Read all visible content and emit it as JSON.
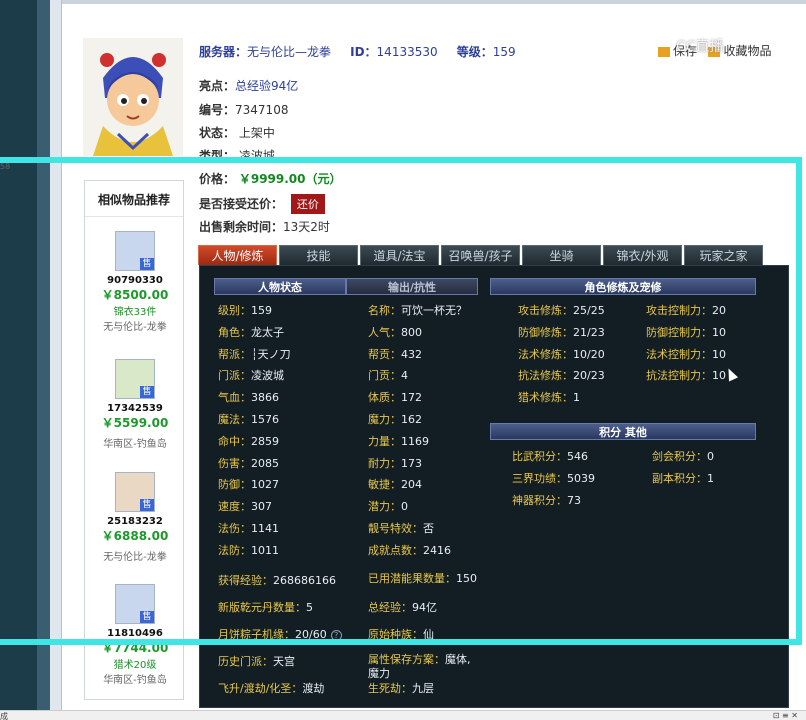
{
  "header": {
    "server_label": "服务器：",
    "server": "无与伦比—龙拳",
    "id_label": "ID：",
    "id": "14133530",
    "level_label": "等级：",
    "level": "159",
    "link1": "保存",
    "link2": "收藏物品",
    "watermark": "CC直播"
  },
  "item": {
    "highlight_label": "亮点：",
    "highlight": "总经验94亿",
    "number_label": "编号：",
    "number": "7347108",
    "status_label": "状态：",
    "status": "上架中",
    "type_label": "类型：",
    "type": "凌波城",
    "price_label": "价格：",
    "price": "￥9999.00（元）",
    "bargain_label": "是否接受还价：",
    "bargain_button": "还价",
    "time_label": "出售剩余时间：",
    "time": "13天2时"
  },
  "sidebar": {
    "title": "相似物品推荐",
    "items": [
      {
        "id": "90790330",
        "price": "￥8500.00",
        "sub1": "锦衣33件",
        "sub2": "无与伦比-龙拳"
      },
      {
        "id": "17342539",
        "price": "￥5599.00",
        "sub1": "",
        "sub2": "华南区-钓鱼岛"
      },
      {
        "id": "25183232",
        "price": "￥6888.00",
        "sub1": "",
        "sub2": "无与伦比-龙拳"
      },
      {
        "id": "11810496",
        "price": "￥7744.00",
        "sub1": "猎术20级",
        "sub2": "华南区-钓鱼岛"
      }
    ],
    "tag": "售"
  },
  "tabs": [
    "人物/修炼",
    "技能",
    "道具/法宝",
    "召唤兽/孩子",
    "坐骑",
    "锦衣/外观",
    "玩家之家"
  ],
  "panel": {
    "head_status": "人物状态",
    "head_output": "输出/抗性",
    "head_cultivation": "角色修炼及宠修",
    "head_points": "积分 其他",
    "left": [
      {
        "l": "级别：",
        "v": "159"
      },
      {
        "l": "角色：",
        "v": "龙太子"
      },
      {
        "l": "帮派：",
        "v": "┆天ノ刀"
      },
      {
        "l": "门派：",
        "v": "凌波城"
      },
      {
        "l": "气血：",
        "v": "3866"
      },
      {
        "l": "魔法：",
        "v": "1576"
      },
      {
        "l": "命中：",
        "v": "2859"
      },
      {
        "l": "伤害：",
        "v": "2085"
      },
      {
        "l": "防御：",
        "v": "1027"
      },
      {
        "l": "速度：",
        "v": "307"
      },
      {
        "l": "法伤：",
        "v": "1141"
      },
      {
        "l": "法防：",
        "v": "1011"
      }
    ],
    "mid": [
      {
        "l": "名称：",
        "v": "可饮一杯无？"
      },
      {
        "l": "人气：",
        "v": "800"
      },
      {
        "l": "帮贡：",
        "v": "432"
      },
      {
        "l": "门贡：",
        "v": "4"
      },
      {
        "l": "体质：",
        "v": "172"
      },
      {
        "l": "魔力：",
        "v": "162"
      },
      {
        "l": "力量：",
        "v": "1169"
      },
      {
        "l": "耐力：",
        "v": "173"
      },
      {
        "l": "敏捷：",
        "v": "204"
      },
      {
        "l": "潜力：",
        "v": "0"
      },
      {
        "l": "靓号特效：",
        "v": "否"
      },
      {
        "l": "成就点数：",
        "v": "2416"
      }
    ],
    "bottom": [
      {
        "l": "获得经验：",
        "v": "268686166"
      },
      {
        "l": "已用潜能果数量：",
        "v": "150"
      },
      {
        "l": "新版乾元丹数量：",
        "v": "5"
      },
      {
        "l": "总经验：",
        "v": "94亿"
      },
      {
        "l": "月饼粽子机缘：",
        "v": "20/60"
      },
      {
        "l": "原始种族：",
        "v": "仙"
      },
      {
        "l": "历史门派：",
        "v": "天宫"
      },
      {
        "l": "属性保存方案：",
        "v": "魔体,魔力"
      },
      {
        "l": "飞升/渡劫/化圣：",
        "v": "渡劫"
      },
      {
        "l": "生死劫：",
        "v": "九层"
      }
    ],
    "cult": [
      {
        "l": "攻击修炼：",
        "v": "25/25",
        "l2": "攻击控制力：",
        "v2": "20"
      },
      {
        "l": "防御修炼：",
        "v": "21/23",
        "l2": "防御控制力：",
        "v2": "10"
      },
      {
        "l": "法术修炼：",
        "v": "10/20",
        "l2": "法术控制力：",
        "v2": "10"
      },
      {
        "l": "抗法修炼：",
        "v": "20/23",
        "l2": "抗法控制力：",
        "v2": "10"
      },
      {
        "l": "猎术修炼：",
        "v": "1",
        "l2": "",
        "v2": ""
      }
    ],
    "points": [
      {
        "l": "比武积分：",
        "v": "546",
        "l2": "剑会积分：",
        "v2": "0"
      },
      {
        "l": "三界功绩：",
        "v": "5039",
        "l2": "副本积分：",
        "v2": "1"
      },
      {
        "l": "神器积分：",
        "v": "73",
        "l2": "",
        "v2": ""
      }
    ]
  },
  "overlay_label": "58",
  "status_bar": "成"
}
